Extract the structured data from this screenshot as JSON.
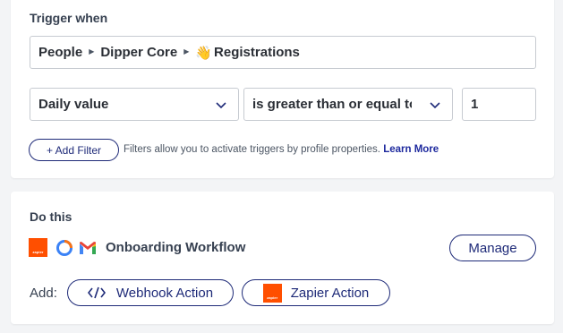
{
  "trigger": {
    "title": "Trigger when",
    "path": {
      "segment1": "People",
      "segment2": "Dipper Core",
      "emoji": "👋",
      "segment3": "Registrations"
    },
    "metric_select": {
      "value": "Daily value"
    },
    "operator_select": {
      "value": "is greater than or equal to"
    },
    "value_input": {
      "value": "1"
    },
    "add_filter_label": "+ Add Filter",
    "filter_help_text": "Filters allow you to activate triggers by profile properties.",
    "learn_more_label": "Learn More"
  },
  "action": {
    "title": "Do this",
    "workflow_name": "Onboarding Workflow",
    "zapier_tile_text": "zapier",
    "manage_label": "Manage",
    "add_label": "Add:",
    "webhook_label": "Webhook Action",
    "zapier_action_label": "Zapier Action"
  },
  "colors": {
    "accent": "#1e2a78",
    "zapier": "#ff4f00",
    "border": "#c7cbd1"
  },
  "icons": [
    "chevron-down-icon",
    "code-icon",
    "zapier-icon",
    "onboarding-app-icon",
    "gmail-icon"
  ]
}
